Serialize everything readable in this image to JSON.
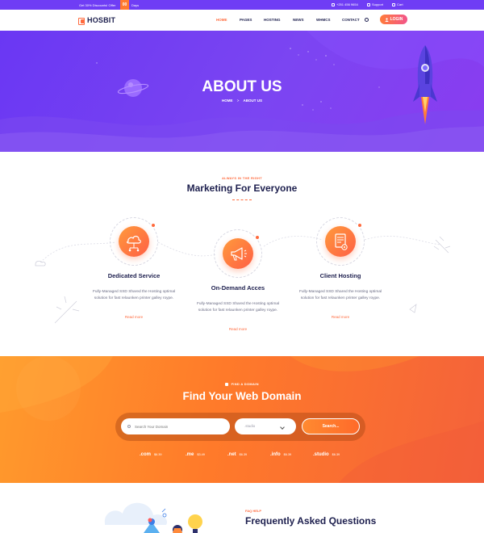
{
  "topbar": {
    "promo": "Get 30% Discounts! Offer",
    "countdown_value": "00",
    "countdown_unit": "Days",
    "phone": "+251 456 9654",
    "support": "Support",
    "cart": "Cart"
  },
  "header": {
    "logo": "HOSBIT",
    "nav": [
      "HOME",
      "PAGES",
      "HOSTING",
      "NEWS",
      "WHMCS",
      "CONTACT"
    ],
    "active_nav": "HOME",
    "login": "LOGIN"
  },
  "hero": {
    "title": "ABOUT US",
    "breadcrumb": [
      "HOME",
      "ABOUT US"
    ],
    "breadcrumb_separator": ">"
  },
  "services": {
    "eyebrow": "ALWAYS IN THE RIGHT",
    "title": "Marketing For Everyone",
    "items": [
      {
        "title": "Dedicated Service",
        "text": "Fully-Managed SSD Shared the Hosting optimal solution for fast relaunken printer galley roype.",
        "link": "Read more",
        "icon": "cloud-network-icon"
      },
      {
        "title": "On-Demand Acces",
        "text": "Fully-Managed SSD Shared the Hosting optimal solution for fast relaunken printer galley roype.",
        "link": "Read more",
        "icon": "megaphone-icon"
      },
      {
        "title": "Client Hosting",
        "text": "Fully-Managed SSD Shared the Hosting optimal solution for fast relaunken printer galley roype.",
        "link": "Read more",
        "icon": "document-settings-icon"
      }
    ]
  },
  "domain": {
    "eyebrow": "FIND A DOMAIN",
    "title": "Find Your Web Domain",
    "search_placeholder": "Search Your Domain",
    "extension_selected": ".studio",
    "search_button": "Search...",
    "tlds": [
      {
        "name": ".com",
        "price": "$6.39"
      },
      {
        "name": ".me",
        "price": "$3.49"
      },
      {
        "name": ".net",
        "price": "$6.39"
      },
      {
        "name": ".info",
        "price": "$6.39"
      },
      {
        "name": ".studio",
        "price": "$6.39"
      }
    ]
  },
  "faq": {
    "eyebrow": "FAQ HELP",
    "title": "Frequently Asked Questions"
  },
  "colors": {
    "brand_purple": "#6f3df5",
    "accent_orange": "#ff6a3d",
    "navy_text": "#1d1f4e"
  }
}
